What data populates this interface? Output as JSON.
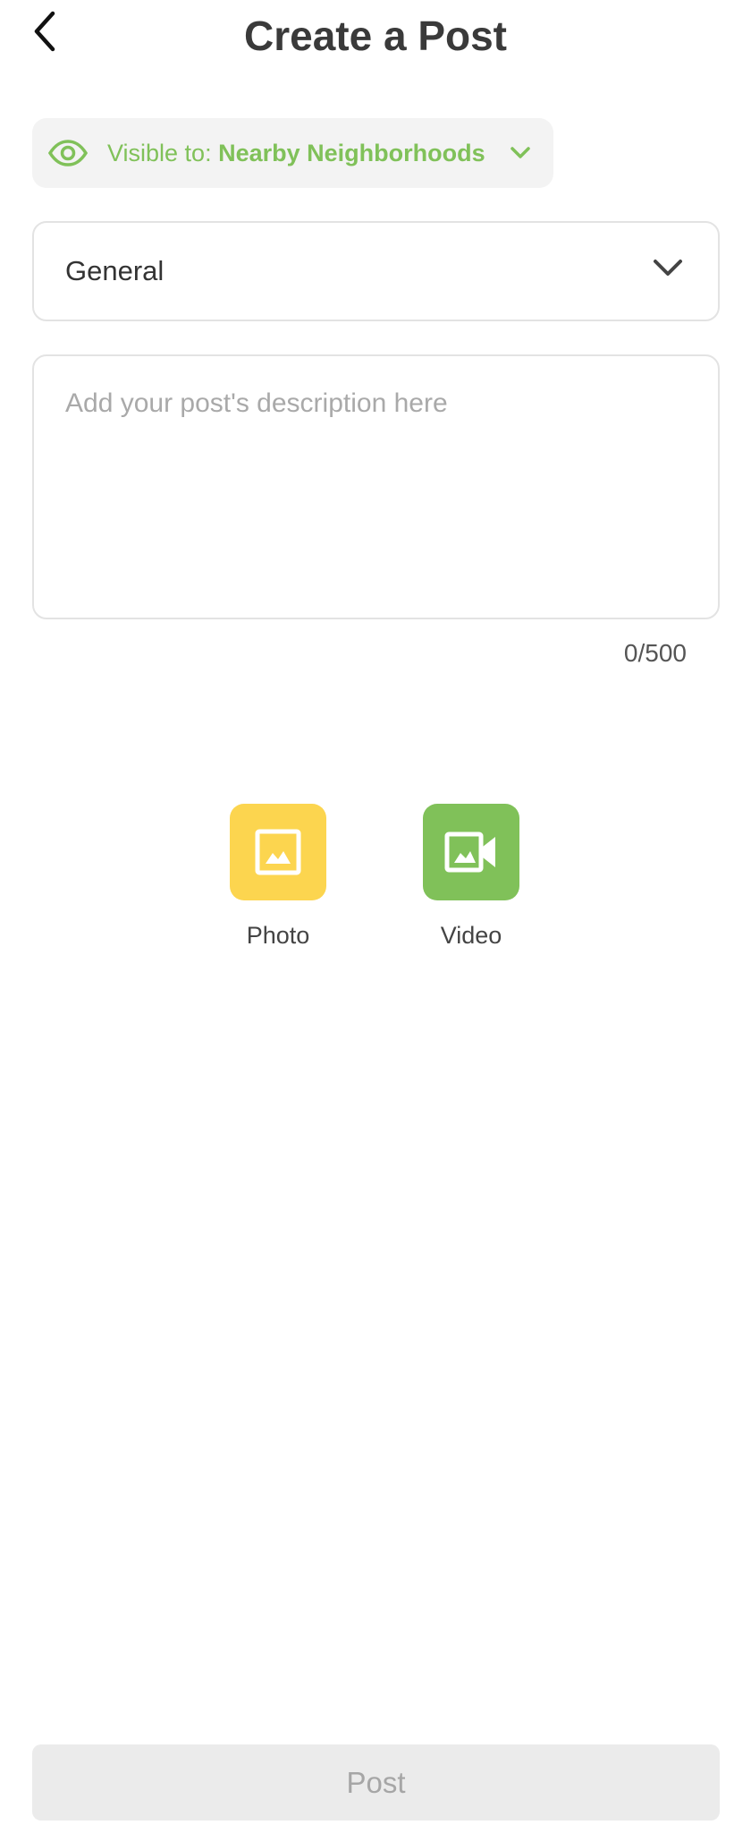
{
  "header": {
    "title": "Create a Post"
  },
  "visibility": {
    "prefix": "Visible to:",
    "value": "Nearby Neighborhoods",
    "accent_color": "#80c159"
  },
  "category": {
    "selected": "General"
  },
  "description": {
    "placeholder": "Add your post's description here",
    "value": "",
    "char_count": "0/500"
  },
  "media": {
    "photo": {
      "label": "Photo",
      "icon": "image-icon",
      "color": "#fcd54f"
    },
    "video": {
      "label": "Video",
      "icon": "video-camera-icon",
      "color": "#80c159"
    }
  },
  "actions": {
    "post_label": "Post"
  }
}
